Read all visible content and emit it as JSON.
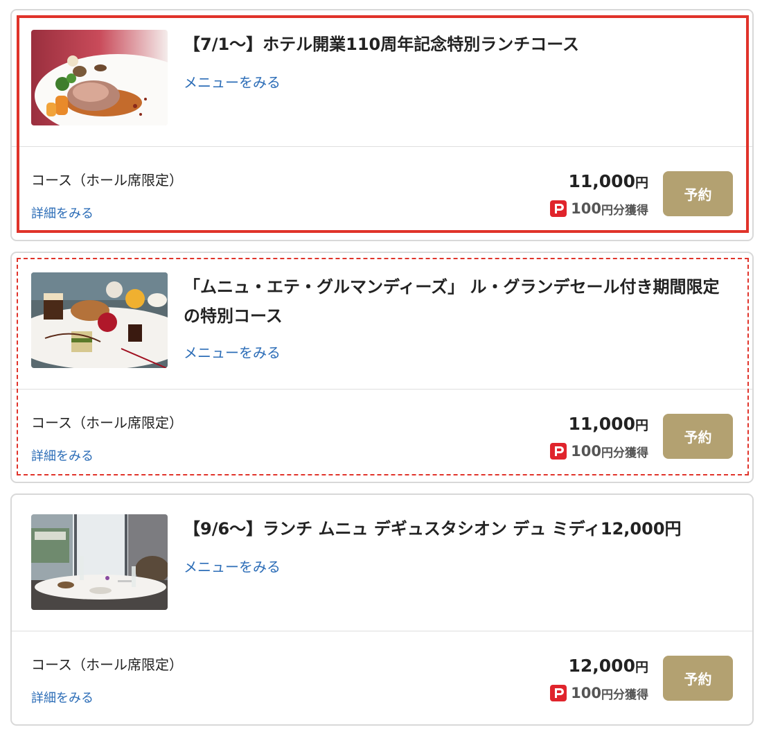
{
  "courses": [
    {
      "title": "【7/1〜】ホテル開業110周年記念特別ランチコース",
      "menu_link": "メニューをみる",
      "seat_type": "コース（ホール席限定）",
      "details_link": "詳細をみる",
      "price": "11,000",
      "price_unit": "円",
      "points": "100",
      "points_suffix": "円分獲得",
      "reserve_label": "予約",
      "image": "roast-meat-dish"
    },
    {
      "title": "「ムニュ・エテ・グルマンディーズ」 ル・グランデセール付き期間限定の特別コース",
      "menu_link": "メニューをみる",
      "seat_type": "コース（ホール席限定）",
      "details_link": "詳細をみる",
      "price": "11,000",
      "price_unit": "円",
      "points": "100",
      "points_suffix": "円分獲得",
      "reserve_label": "予約",
      "image": "dessert-plate"
    },
    {
      "title": "【9/6〜】ランチ ムニュ デギュスタシオン デュ ミディ12,000円",
      "menu_link": "メニューをみる",
      "seat_type": "コース（ホール席限定）",
      "details_link": "詳細をみる",
      "price": "12,000",
      "price_unit": "円",
      "points": "100",
      "points_suffix": "円分獲得",
      "reserve_label": "予約",
      "image": "restaurant-table"
    }
  ],
  "colors": {
    "link": "#2c6db7",
    "reserve_button": "#b3a171",
    "highlight": "#e0332a",
    "paypay": "#e0242c"
  }
}
